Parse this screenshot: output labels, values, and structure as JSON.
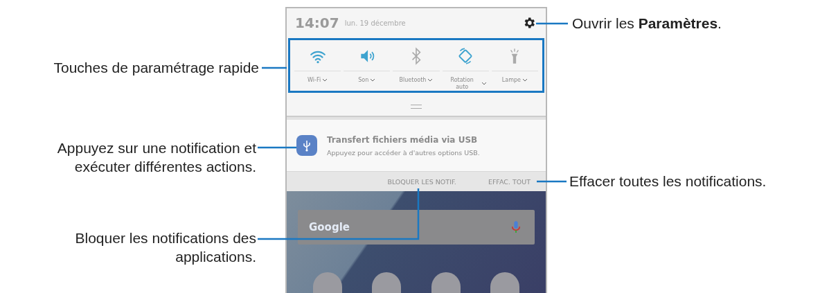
{
  "status_header": {
    "time": "14:07",
    "date": "lun. 19 décembre"
  },
  "quick_settings": [
    {
      "kind": "wifi",
      "label": "Wi-Fi",
      "on": true
    },
    {
      "kind": "sound",
      "label": "Son",
      "on": true
    },
    {
      "kind": "bluetooth",
      "label": "Bluetooth",
      "on": false
    },
    {
      "kind": "rotation",
      "label": "Rotation auto",
      "on": true
    },
    {
      "kind": "flashlight",
      "label": "Lampe",
      "on": false
    }
  ],
  "notification": {
    "title": "Transfert fichiers média via USB",
    "body": "Appuyez pour accéder à d'autres options USB."
  },
  "actions": [
    "BLOQUER LES NOTIF.",
    "EFFAC. TOUT"
  ],
  "search_bar": {
    "logo": "Google"
  },
  "callouts": [
    {
      "text": "Ouvrir les **Paramètres**."
    },
    {
      "text": "Touches de paramétrage rapide"
    },
    {
      "text": "Appuyez sur une notification et exécuter différentes actions."
    },
    {
      "text": "Effacer toutes les notifications."
    },
    {
      "text": "Bloquer les notifications des applications."
    }
  ]
}
